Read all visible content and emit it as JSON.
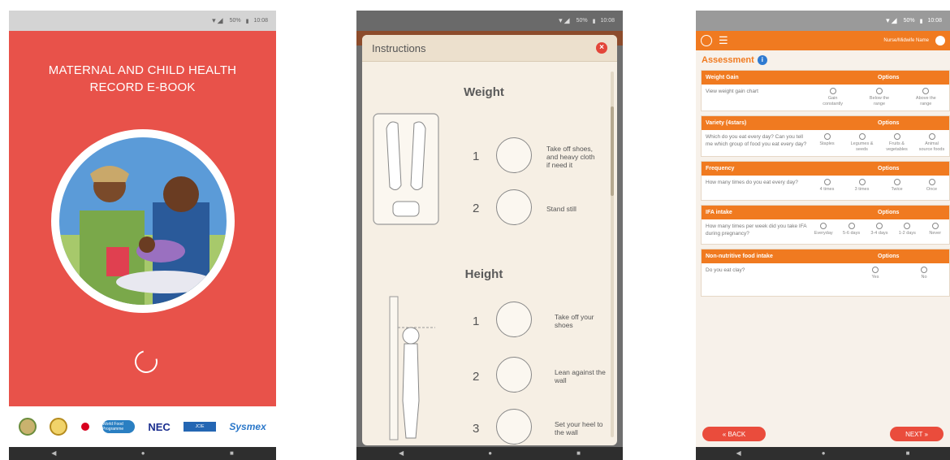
{
  "screen1": {
    "title_line1": "MATERNAL AND CHILD HEALTH",
    "title_line2": "RECORD E-BOOK",
    "status_time": "10:08",
    "status_battery": "50%",
    "logos": [
      "ghana-coat-of-arms",
      "ghana-health-service",
      "jica",
      "wfp",
      "nec",
      "jcie",
      "sysmex"
    ],
    "logo_wfp_text": "World Food Programme",
    "logo_nec_text": "NEC",
    "logo_jcie_text": "JCIE",
    "logo_sysmex_text": "Sysmex",
    "colors": {
      "background": "#e8524a",
      "accent": "#ffffff"
    }
  },
  "screen2": {
    "modal_title": "Instructions",
    "status_time": "10:08",
    "status_battery": "50%",
    "weight": {
      "heading": "Weight",
      "steps": [
        {
          "n": "1",
          "text": "Take off shoes, and heavy cloth if need it"
        },
        {
          "n": "2",
          "text": "Stand still"
        }
      ]
    },
    "height": {
      "heading": "Height",
      "steps": [
        {
          "n": "1",
          "text": "Take off your shoes"
        },
        {
          "n": "2",
          "text": "Lean against the wall"
        },
        {
          "n": "3",
          "text": "Set your heel to the wall"
        }
      ]
    }
  },
  "screen3": {
    "status_time": "10:08",
    "status_battery": "50%",
    "user_label": "Nurse/Midwife Name",
    "heading": "Assessment",
    "cards": [
      {
        "title": "Weight Gain",
        "options_label": "Options",
        "question": "View weight gain chart",
        "options": [
          "Gain constantly",
          "Below the range",
          "Above the range"
        ]
      },
      {
        "title": "Variety (4stars)",
        "options_label": "Options",
        "question": "Which do you eat every day? Can you tell me which group of food you eat every day?",
        "options": [
          "Staples",
          "Legumes & seeds",
          "Fruits & vegetables",
          "Animal source foods"
        ]
      },
      {
        "title": "Frequency",
        "options_label": "Options",
        "question": "How many times do you eat every day?",
        "options": [
          "4 times",
          "3 times",
          "Twice",
          "Once"
        ]
      },
      {
        "title": "IFA intake",
        "options_label": "Options",
        "question": "How many times per week did you take IFA during pregnancy?",
        "options": [
          "Everyday",
          "5-6 days",
          "3-4 days",
          "1-2 days",
          "Never"
        ]
      },
      {
        "title": "Non-nutritive food intake",
        "options_label": "Options",
        "question": "Do you eat clay?",
        "options": [
          "Yes",
          "No"
        ]
      }
    ],
    "back_label": "« BACK",
    "next_label": "NEXT »",
    "colors": {
      "accent": "#f07a20",
      "button": "#ea4c3c"
    }
  }
}
